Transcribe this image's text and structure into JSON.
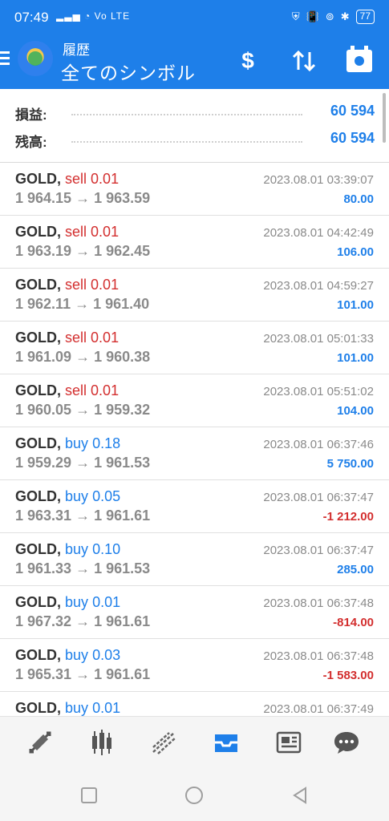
{
  "status": {
    "time": "07:49",
    "signal": "··•• ",
    "net": "Vo LTE",
    "battery": "77"
  },
  "header": {
    "subtitle": "履歴",
    "title": "全てのシンボル"
  },
  "summary": [
    {
      "label": "損益:",
      "value": "60 594"
    },
    {
      "label": "残高:",
      "value": "60 594"
    }
  ],
  "trades": [
    {
      "symbol": "GOLD,",
      "side": "sell",
      "lot": "0.01",
      "prices": "1 964.15 → 1 963.59",
      "time": "2023.08.01 03:39:07",
      "profit": "80.00",
      "sign": "pos"
    },
    {
      "symbol": "GOLD,",
      "side": "sell",
      "lot": "0.01",
      "prices": "1 963.19 → 1 962.45",
      "time": "2023.08.01 04:42:49",
      "profit": "106.00",
      "sign": "pos"
    },
    {
      "symbol": "GOLD,",
      "side": "sell",
      "lot": "0.01",
      "prices": "1 962.11 → 1 961.40",
      "time": "2023.08.01 04:59:27",
      "profit": "101.00",
      "sign": "pos"
    },
    {
      "symbol": "GOLD,",
      "side": "sell",
      "lot": "0.01",
      "prices": "1 961.09 → 1 960.38",
      "time": "2023.08.01 05:01:33",
      "profit": "101.00",
      "sign": "pos"
    },
    {
      "symbol": "GOLD,",
      "side": "sell",
      "lot": "0.01",
      "prices": "1 960.05 → 1 959.32",
      "time": "2023.08.01 05:51:02",
      "profit": "104.00",
      "sign": "pos"
    },
    {
      "symbol": "GOLD,",
      "side": "buy",
      "lot": "0.18",
      "prices": "1 959.29 → 1 961.53",
      "time": "2023.08.01 06:37:46",
      "profit": "5 750.00",
      "sign": "pos"
    },
    {
      "symbol": "GOLD,",
      "side": "buy",
      "lot": "0.05",
      "prices": "1 963.31 → 1 961.61",
      "time": "2023.08.01 06:37:47",
      "profit": "-1 212.00",
      "sign": "neg"
    },
    {
      "symbol": "GOLD,",
      "side": "buy",
      "lot": "0.10",
      "prices": "1 961.33 → 1 961.53",
      "time": "2023.08.01 06:37:47",
      "profit": "285.00",
      "sign": "pos"
    },
    {
      "symbol": "GOLD,",
      "side": "buy",
      "lot": "0.01",
      "prices": "1 967.32 → 1 961.61",
      "time": "2023.08.01 06:37:48",
      "profit": "-814.00",
      "sign": "neg"
    },
    {
      "symbol": "GOLD,",
      "side": "buy",
      "lot": "0.03",
      "prices": "1 965.31 → 1 961.61",
      "time": "2023.08.01 06:37:48",
      "profit": "-1 583.00",
      "sign": "neg"
    },
    {
      "symbol": "GOLD,",
      "side": "buy",
      "lot": "0.01",
      "prices": "",
      "time": "2023.08.01 06:37:49",
      "profit": "",
      "sign": "pos"
    }
  ],
  "tabs": [
    {
      "name": "tab-quotes",
      "icon": "arrows-diagonal-icon"
    },
    {
      "name": "tab-chart",
      "icon": "candlestick-icon"
    },
    {
      "name": "tab-trade",
      "icon": "trend-lines-icon"
    },
    {
      "name": "tab-history",
      "icon": "inbox-tray-icon",
      "active": true
    },
    {
      "name": "tab-news",
      "icon": "newspaper-icon"
    },
    {
      "name": "tab-messages",
      "icon": "chat-bubble-icon"
    }
  ],
  "colors": {
    "accent": "#1e7fe9",
    "negative": "#d32f2f",
    "muted": "#8a8a8a"
  }
}
